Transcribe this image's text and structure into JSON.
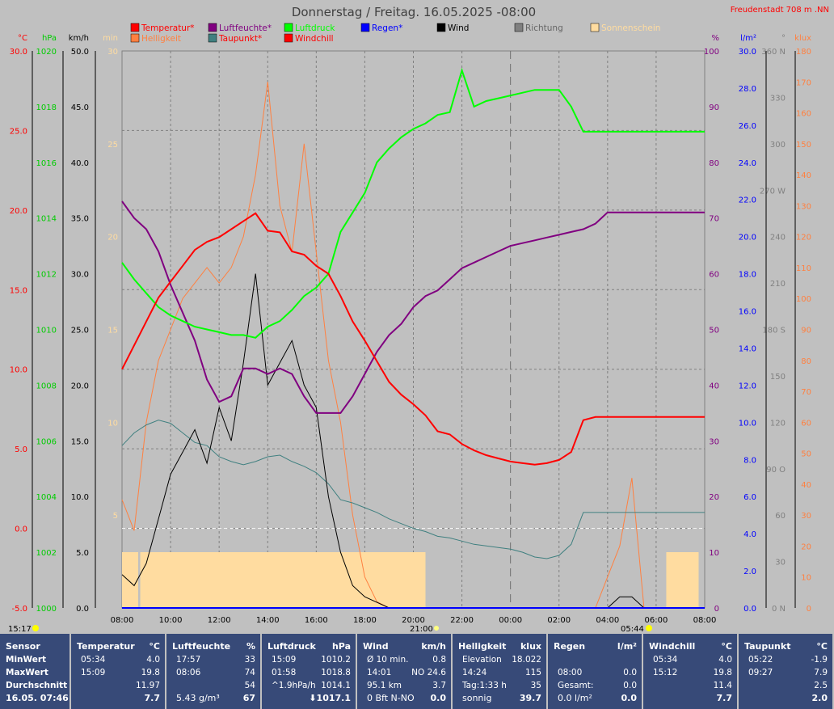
{
  "header": {
    "title": "Donnerstag / Freitag. 16.05.2025  -08:00",
    "station": "Freudenstadt 708 m  .NN"
  },
  "legend": [
    {
      "label": "Temperatur*",
      "color": "#ff0000",
      "text_color": "#ff0000"
    },
    {
      "label": "Luftfeuchte*",
      "color": "#800080",
      "text_color": "#800080"
    },
    {
      "label": "Luftdruck",
      "color": "#00ff00",
      "text_color": "#00ff00"
    },
    {
      "label": "Regen*",
      "color": "#0000ff",
      "text_color": "#0000ff"
    },
    {
      "label": "Wind",
      "color": "#000000",
      "text_color": "#000000"
    },
    {
      "label": "Richtung",
      "color": "#808080",
      "text_color": "#666666"
    },
    {
      "label": "Sonnenschein",
      "color": "#ffdca0",
      "text_color": "#ffdca0"
    },
    {
      "label": "Helligkeit",
      "color": "#ff8040",
      "text_color": "#ff8040"
    },
    {
      "label": "Taupunkt*",
      "color": "#408080",
      "text_color": "#ff0000"
    },
    {
      "label": "Windchill",
      "color": "#ff0000",
      "text_color": "#ff0000"
    }
  ],
  "axes": {
    "temp": {
      "unit": "°C",
      "color": "#ff0000",
      "ticks": [
        "30.0",
        "25.0",
        "20.0",
        "15.0",
        "10.0",
        "5.0",
        "0.0",
        "-5.0"
      ]
    },
    "pressure": {
      "unit": "hPa",
      "color": "#00cc00",
      "ticks": [
        "1020",
        "1018",
        "1016",
        "1014",
        "1012",
        "1010",
        "1008",
        "1006",
        "1004",
        "1002",
        "1000"
      ]
    },
    "wind": {
      "unit": "km/h",
      "color": "#000000",
      "ticks": [
        "50.0",
        "45.0",
        "40.0",
        "35.0",
        "30.0",
        "25.0",
        "20.0",
        "15.0",
        "10.0",
        "5.0",
        "0.0"
      ]
    },
    "sun_min": {
      "unit": "min",
      "color": "#ffdca0",
      "ticks": [
        "30",
        "25",
        "20",
        "15",
        "10",
        "5"
      ]
    },
    "humidity": {
      "unit": "%",
      "color": "#800080",
      "ticks": [
        "100",
        "90",
        "80",
        "70",
        "60",
        "50",
        "40",
        "30",
        "20",
        "10",
        "0"
      ]
    },
    "rain": {
      "unit": "l/m²",
      "color": "#0000ff",
      "ticks": [
        "30.0",
        "28.0",
        "26.0",
        "24.0",
        "22.0",
        "20.0",
        "18.0",
        "16.0",
        "14.0",
        "12.0",
        "10.0",
        "8.0",
        "6.0",
        "4.0",
        "2.0",
        "0.0"
      ]
    },
    "direction": {
      "unit": "°",
      "color": "#808080",
      "ticks": [
        "360 N",
        "330",
        "300",
        "270 W",
        "240",
        "210",
        "180 S",
        "150",
        "120",
        "90  O",
        "60",
        "30",
        "0  N"
      ]
    },
    "lux": {
      "unit": "klux",
      "color": "#ff8040",
      "ticks": [
        "180",
        "170",
        "160",
        "150",
        "140",
        "130",
        "120",
        "110",
        "100",
        "90",
        "80",
        "70",
        "60",
        "50",
        "40",
        "30",
        "20",
        "10",
        "0"
      ]
    },
    "time_ticks": [
      "08:00",
      "10:00",
      "12:00",
      "14:00",
      "16:00",
      "18:00",
      "20:00",
      "22:00",
      "00:00",
      "02:00",
      "04:00",
      "06:00",
      "08:00"
    ]
  },
  "events": {
    "sunrise_left": "15:17",
    "sunset": "21:00",
    "sunrise": "05:44"
  },
  "chart_data": {
    "type": "line",
    "x_range": [
      "08:00",
      "08:00"
    ],
    "x_hours": [
      0,
      0.5,
      1,
      1.5,
      2,
      2.5,
      3,
      3.5,
      4,
      4.5,
      5,
      5.5,
      6,
      6.5,
      7,
      7.5,
      8,
      8.5,
      9,
      9.5,
      10,
      10.5,
      11,
      11.5,
      12,
      12.5,
      13,
      13.5,
      14,
      14.5,
      15,
      15.5,
      16,
      16.5,
      17,
      17.5,
      18,
      18.5,
      19,
      19.5,
      20,
      20.5,
      21,
      21.5,
      22,
      22.5,
      23,
      23.5,
      24
    ],
    "series": [
      {
        "name": "Temperatur*",
        "axis": "temp",
        "color": "#ff0000",
        "values": [
          10,
          11.5,
          13,
          14.5,
          15.5,
          16.5,
          17.5,
          18,
          18.3,
          18.8,
          19.3,
          19.8,
          18.7,
          18.6,
          17.4,
          17.2,
          16.5,
          16,
          14.6,
          13,
          11.8,
          10.5,
          9.2,
          8.4,
          7.8,
          7.1,
          6.1,
          5.9,
          5.3,
          4.9,
          4.6,
          4.4,
          4.2,
          4.1,
          4.0,
          4.1,
          4.3,
          4.8,
          6.8,
          7,
          7,
          7,
          7,
          7,
          7,
          7,
          7,
          7,
          7
        ]
      },
      {
        "name": "Luftfeuchte*",
        "axis": "humidity",
        "color": "#800080",
        "values": [
          73,
          70,
          68,
          64,
          58,
          53,
          48,
          41,
          37,
          38,
          43,
          43,
          42,
          43,
          42,
          38,
          35,
          35,
          35,
          38,
          42,
          46,
          49,
          51,
          54,
          56,
          57,
          59,
          61,
          62,
          63,
          64,
          65,
          65.5,
          66,
          66.5,
          67,
          67.5,
          68,
          69,
          71,
          71,
          71,
          71,
          71,
          71,
          71,
          71,
          71
        ]
      },
      {
        "name": "Luftdruck",
        "axis": "pressure",
        "color": "#00ff00",
        "values": [
          1012.4,
          1011.8,
          1011.3,
          1010.8,
          1010.5,
          1010.3,
          1010.1,
          1010.0,
          1009.9,
          1009.8,
          1009.8,
          1009.7,
          1010.1,
          1010.3,
          1010.7,
          1011.2,
          1011.5,
          1012,
          1013.5,
          1014.2,
          1014.9,
          1016.0,
          1016.5,
          1016.9,
          1017.2,
          1017.4,
          1017.7,
          1017.8,
          1019.3,
          1018.0,
          1018.2,
          1018.3,
          1018.4,
          1018.5,
          1018.6,
          1018.6,
          1018.6,
          1018.0,
          1017.1,
          1017.1,
          1017.1,
          1017.1,
          1017.1,
          1017.1,
          1017.1,
          1017.1,
          1017.1,
          1017.1,
          1017.1
        ]
      },
      {
        "name": "Taupunkt*",
        "axis": "temp",
        "color": "#408080",
        "values": [
          5.2,
          6,
          6.5,
          6.8,
          6.6,
          6,
          5.4,
          5.2,
          4.5,
          4.2,
          4,
          4.2,
          4.5,
          4.6,
          4.2,
          3.9,
          3.5,
          2.8,
          1.8,
          1.6,
          1.3,
          1.0,
          0.6,
          0.3,
          0,
          -0.2,
          -0.5,
          -0.6,
          -0.8,
          -1.0,
          -1.1,
          -1.2,
          -1.3,
          -1.5,
          -1.8,
          -1.9,
          -1.7,
          -1.0,
          1.0,
          1.0,
          1,
          1,
          1,
          1,
          1,
          1,
          1,
          1,
          1
        ]
      },
      {
        "name": "Helligkeit",
        "axis": "lux",
        "color": "#ff8040",
        "values": [
          35,
          25,
          60,
          80,
          90,
          100,
          105,
          110,
          105,
          110,
          120,
          140,
          170,
          130,
          115,
          150,
          115,
          80,
          60,
          30,
          10,
          2,
          0,
          0,
          0,
          0,
          0,
          0,
          0,
          0,
          0,
          0,
          0,
          0,
          0,
          0,
          0,
          0,
          0,
          0,
          10,
          20,
          42,
          0,
          0,
          0,
          0,
          0,
          0
        ]
      },
      {
        "name": "Wind",
        "axis": "wind",
        "color": "#000000",
        "values": [
          3,
          2,
          4,
          8,
          12,
          14,
          16,
          13,
          18,
          15,
          22,
          30,
          20,
          22,
          24,
          20,
          18,
          10,
          5,
          2,
          1,
          0.5,
          0,
          0,
          0,
          0,
          0,
          0,
          0,
          0,
          0,
          0,
          0,
          0,
          0,
          0,
          0,
          0,
          0,
          0,
          0,
          1,
          1,
          0,
          0,
          0,
          0,
          0,
          0
        ]
      },
      {
        "name": "Regen*",
        "axis": "rain",
        "color": "#0000ff",
        "values": [
          0,
          0,
          0,
          0,
          0,
          0,
          0,
          0,
          0,
          0,
          0,
          0,
          0,
          0,
          0,
          0,
          0,
          0,
          0,
          0,
          0,
          0,
          0,
          0,
          0,
          0,
          0,
          0,
          0,
          0,
          0,
          0,
          0,
          0,
          0,
          0,
          0,
          0,
          0,
          0,
          0,
          0,
          0,
          0,
          0,
          0,
          0,
          0,
          0
        ]
      }
    ],
    "sunshine_intervals": [
      [
        "08:00",
        "08:40"
      ],
      [
        "08:45",
        "20:30"
      ],
      [
        "06:25",
        "07:45"
      ]
    ],
    "grid": true
  },
  "table": {
    "columns": [
      {
        "title": "Sensor",
        "unit": "",
        "rows": [
          [
            "MinWert",
            ""
          ],
          [
            "MaxWert",
            ""
          ],
          [
            "Durchschnitt",
            ""
          ]
        ],
        "footer": [
          "16.05. 07:46",
          ""
        ]
      },
      {
        "title": "Temperatur",
        "unit": "°C",
        "rows": [
          [
            "05:34",
            "4.0"
          ],
          [
            "15:09",
            "19.8"
          ],
          [
            "",
            "11.97"
          ]
        ],
        "footer": [
          "",
          "7.7"
        ]
      },
      {
        "title": "Luftfeuchte",
        "unit": "%",
        "rows": [
          [
            "17:57",
            "33"
          ],
          [
            "08:06",
            "74"
          ],
          [
            "",
            "54"
          ]
        ],
        "footer": [
          "5.43 g/m³",
          "67"
        ]
      },
      {
        "title": "Luftdruck",
        "unit": "hPa",
        "rows": [
          [
            "15:09",
            "1010.2"
          ],
          [
            "01:58",
            "1018.8"
          ],
          [
            "^1.9hPa/h",
            "1014.1"
          ]
        ],
        "footer": [
          "",
          "⬇1017.1"
        ]
      },
      {
        "title": "Wind",
        "unit": "km/h",
        "rows": [
          [
            "Ø 10 min.",
            "0.8"
          ],
          [
            "14:01",
            "NO 24.6"
          ],
          [
            "95.1 km",
            "3.7"
          ]
        ],
        "footer": [
          "0 Bft N-NO",
          "0.0"
        ]
      },
      {
        "title": "Helligkeit",
        "unit": "klux",
        "rows": [
          [
            "Elevation",
            "18.022"
          ],
          [
            "14:24",
            "115"
          ],
          [
            "Tag:1:33 h",
            "35"
          ]
        ],
        "footer": [
          "sonnig",
          "39.7"
        ]
      },
      {
        "title": "Regen",
        "unit": "l/m²",
        "rows": [
          [
            "",
            ""
          ],
          [
            "08:00",
            "0.0"
          ],
          [
            "Gesamt:",
            "0.0"
          ]
        ],
        "footer": [
          "0.0 l/m²",
          "0.0"
        ]
      },
      {
        "title": "Windchill",
        "unit": "°C",
        "rows": [
          [
            "05:34",
            "4.0"
          ],
          [
            "15:12",
            "19.8"
          ],
          [
            "",
            "11.4"
          ]
        ],
        "footer": [
          "",
          "7.7"
        ]
      },
      {
        "title": "Taupunkt",
        "unit": "°C",
        "rows": [
          [
            "05:22",
            "-1.9"
          ],
          [
            "09:27",
            "7.9"
          ],
          [
            "",
            "2.5"
          ]
        ],
        "footer": [
          "",
          "2.0"
        ]
      }
    ]
  }
}
